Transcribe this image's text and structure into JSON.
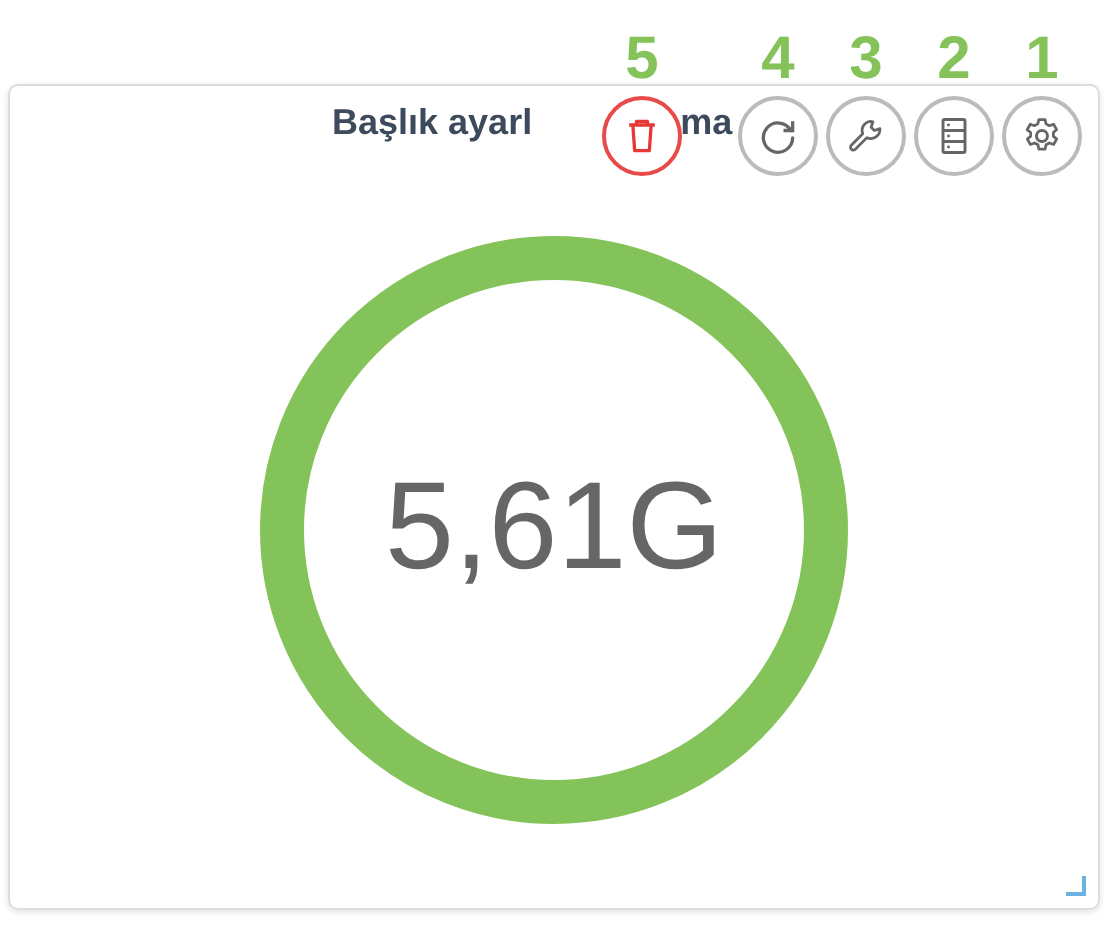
{
  "card": {
    "title_parts": [
      "Başlık ayarl",
      "ma"
    ],
    "value": "5,61G"
  },
  "toolbar": [
    {
      "kind": "delete",
      "number": "5"
    },
    {
      "kind": "refresh",
      "number": "4"
    },
    {
      "kind": "wrench",
      "number": "3"
    },
    {
      "kind": "server",
      "number": "2"
    },
    {
      "kind": "settings",
      "number": "1"
    }
  ]
}
